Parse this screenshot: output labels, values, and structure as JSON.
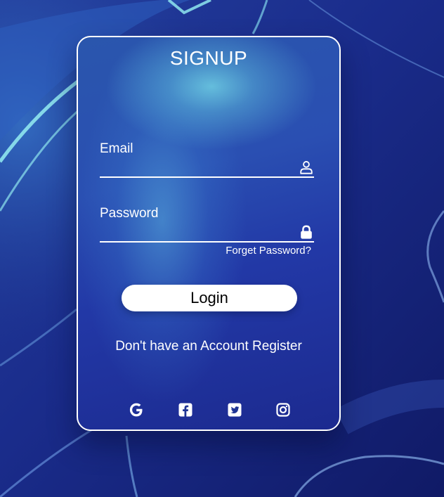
{
  "form": {
    "title": "SIGNUP",
    "email": {
      "label": "Email",
      "value": "",
      "icon": "person-icon"
    },
    "password": {
      "label": "Password",
      "value": "",
      "icon": "lock-icon"
    },
    "forget_password": "Forget Password?",
    "login_button": "Login",
    "register": {
      "prompt": "Don't have an Account",
      "link": "Register"
    },
    "socials": [
      {
        "name": "google-icon"
      },
      {
        "name": "facebook-icon"
      },
      {
        "name": "twitter-icon"
      },
      {
        "name": "instagram-icon"
      }
    ]
  },
  "colors": {
    "background": "#1b2f86",
    "card_border": "#ffffff",
    "text": "#ffffff",
    "button_bg": "#ffffff",
    "button_text": "#000000"
  }
}
